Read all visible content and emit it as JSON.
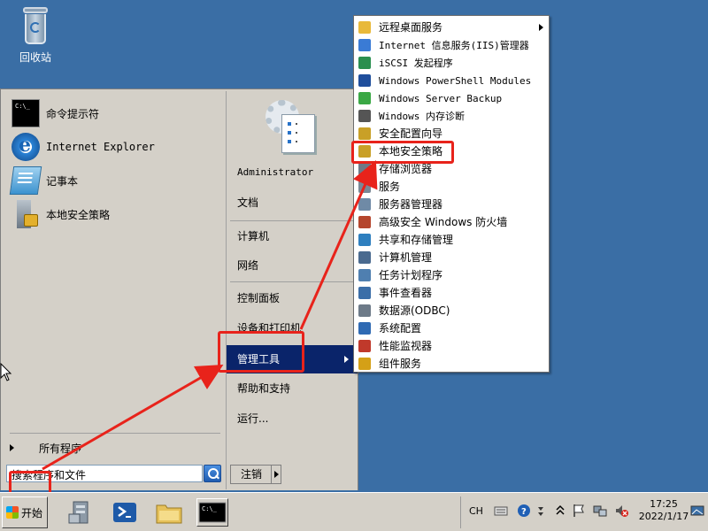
{
  "desktop": {
    "recycle_bin": "回收站"
  },
  "start_menu": {
    "programs": [
      "命令提示符",
      "Internet Explorer",
      "记事本",
      "本地安全策略"
    ],
    "all_programs": "所有程序",
    "search_placeholder": "搜索程序和文件",
    "right_items": {
      "user": "Administrator",
      "documents": "文档",
      "computer": "计算机",
      "network": "网络",
      "control_panel": "控制面板",
      "devices_printers": "设备和打印机",
      "admin_tools": "管理工具",
      "help": "帮助和支持",
      "run": "运行..."
    },
    "logoff": "注销"
  },
  "admin_submenu": [
    {
      "label": "远程桌面服务",
      "icon": "folder-icon",
      "color": "#e8b93a"
    },
    {
      "label": "Internet 信息服务(IIS)管理器",
      "icon": "iis-icon",
      "color": "#3a7bd5"
    },
    {
      "label": "iSCSI 发起程序",
      "icon": "globe-icon",
      "color": "#2a8f4f"
    },
    {
      "label": "Windows PowerShell Modules",
      "icon": "powershell-icon",
      "color": "#1f4e9c"
    },
    {
      "label": "Windows Server Backup",
      "icon": "backup-icon",
      "color": "#3aa845"
    },
    {
      "label": "Windows 内存诊断",
      "icon": "memory-icon",
      "color": "#555555"
    },
    {
      "label": "安全配置向导",
      "icon": "lock-icon",
      "color": "#c9a027"
    },
    {
      "label": "本地安全策略",
      "icon": "security-policy-icon",
      "color": "#c9a027"
    },
    {
      "label": "存储浏览器",
      "icon": "storage-icon",
      "color": "#6d7a88"
    },
    {
      "label": "服务",
      "icon": "services-icon",
      "color": "#7a8896"
    },
    {
      "label": "服务器管理器",
      "icon": "server-manager-icon",
      "color": "#6f8aa6"
    },
    {
      "label": "高级安全 Windows 防火墙",
      "icon": "firewall-icon",
      "color": "#b5462d"
    },
    {
      "label": "共享和存储管理",
      "icon": "share-icon",
      "color": "#2e7fbf"
    },
    {
      "label": "计算机管理",
      "icon": "computer-mgmt-icon",
      "color": "#4a6a8f"
    },
    {
      "label": "任务计划程序",
      "icon": "clock-icon",
      "color": "#4f7fb0"
    },
    {
      "label": "事件查看器",
      "icon": "event-viewer-icon",
      "color": "#3b6ea8"
    },
    {
      "label": "数据源(ODBC)",
      "icon": "odbc-icon",
      "color": "#6d7a88"
    },
    {
      "label": "系统配置",
      "icon": "sysconfig-icon",
      "color": "#2f6ab3"
    },
    {
      "label": "性能监视器",
      "icon": "perf-monitor-icon",
      "color": "#c0392b"
    },
    {
      "label": "组件服务",
      "icon": "component-icon",
      "color": "#d4a017"
    }
  ],
  "taskbar": {
    "start": "开始",
    "lang": "CH",
    "time": "17:25",
    "date": "2022/1/17"
  },
  "colors": {
    "highlight": "#0a246a",
    "annotation": "#e8231b",
    "desktop": "#3a6ea5"
  }
}
